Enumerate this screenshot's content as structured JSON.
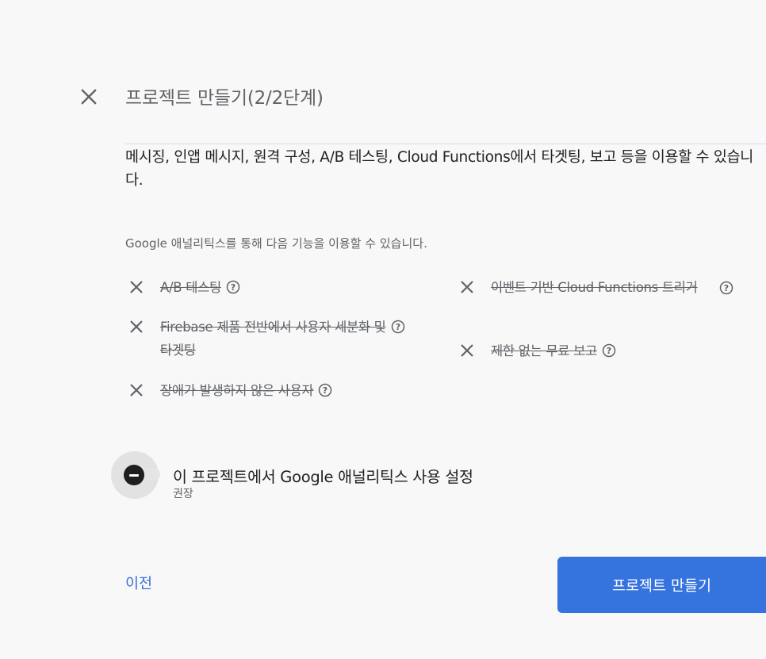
{
  "dialog": {
    "title": "프로젝트 만들기(2/2단계)",
    "intro": "메시징, 인앱 메시지, 원격 구성, A/B 테스팅, Cloud Functions에서 타겟팅, 보고 등을 이용할 수 있습니다.",
    "subtitle": "Google 애널리틱스를 통해 다음 기능을 이용할 수 있습니다."
  },
  "features": [
    {
      "label": "A/B 테스팅",
      "icon": "close-icon",
      "help": "help-circle-icon"
    },
    {
      "label": "Firebase 제품 전반에서 사용자 세분화 및 타겟팅",
      "icon": "close-icon",
      "help": "help-circle-icon"
    },
    {
      "label": "장애가 발생하지 않은 사용자",
      "icon": "close-icon",
      "help": "help-circle-icon"
    },
    {
      "label": "이벤트 기반 Cloud Functions 트리거",
      "icon": "close-icon",
      "help": "help-circle-icon"
    },
    {
      "label": "제한 없는 무료 보고",
      "icon": "close-icon",
      "help": "help-circle-icon"
    }
  ],
  "analytics_toggle": {
    "label": "이 프로젝트에서 Google 애널리틱스 사용 설정",
    "sublabel": "권장",
    "enabled": false
  },
  "actions": {
    "prev_label": "이전",
    "create_label": "프로젝트 만들기"
  },
  "colors": {
    "primary": "#3573df",
    "link": "#3b6fd6",
    "muted_text": "#5f6368",
    "background": "#f8f8f8"
  }
}
